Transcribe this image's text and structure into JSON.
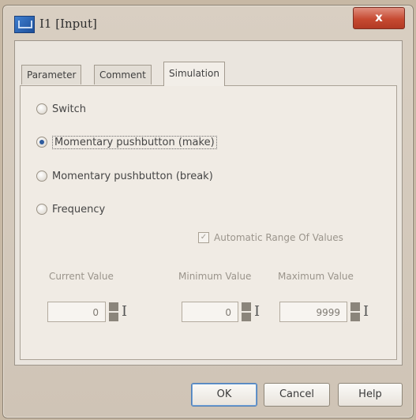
{
  "window": {
    "title": "I1 [Input]",
    "close_glyph": "x"
  },
  "tabs": [
    {
      "label": "Parameter",
      "active": false
    },
    {
      "label": "Comment",
      "active": false
    },
    {
      "label": "Simulation",
      "active": true
    }
  ],
  "simulation": {
    "options": [
      {
        "label": "Switch",
        "checked": false
      },
      {
        "label": "Momentary pushbutton (make)",
        "checked": true
      },
      {
        "label": "Momentary pushbutton (break)",
        "checked": false
      },
      {
        "label": "Frequency",
        "checked": false
      }
    ],
    "auto_range": {
      "label": "Automatic Range Of Values",
      "checked": true,
      "enabled": false
    },
    "fields": {
      "current": {
        "label": "Current Value",
        "value": "0"
      },
      "minimum": {
        "label": "Minimum Value",
        "value": "0"
      },
      "maximum": {
        "label": "Maximum Value",
        "value": "9999"
      }
    }
  },
  "buttons": {
    "ok": "OK",
    "cancel": "Cancel",
    "help": "Help"
  },
  "colors": {
    "accent": "#2f5c9e",
    "close": "#c64a32",
    "background": "#c7b8a4"
  }
}
